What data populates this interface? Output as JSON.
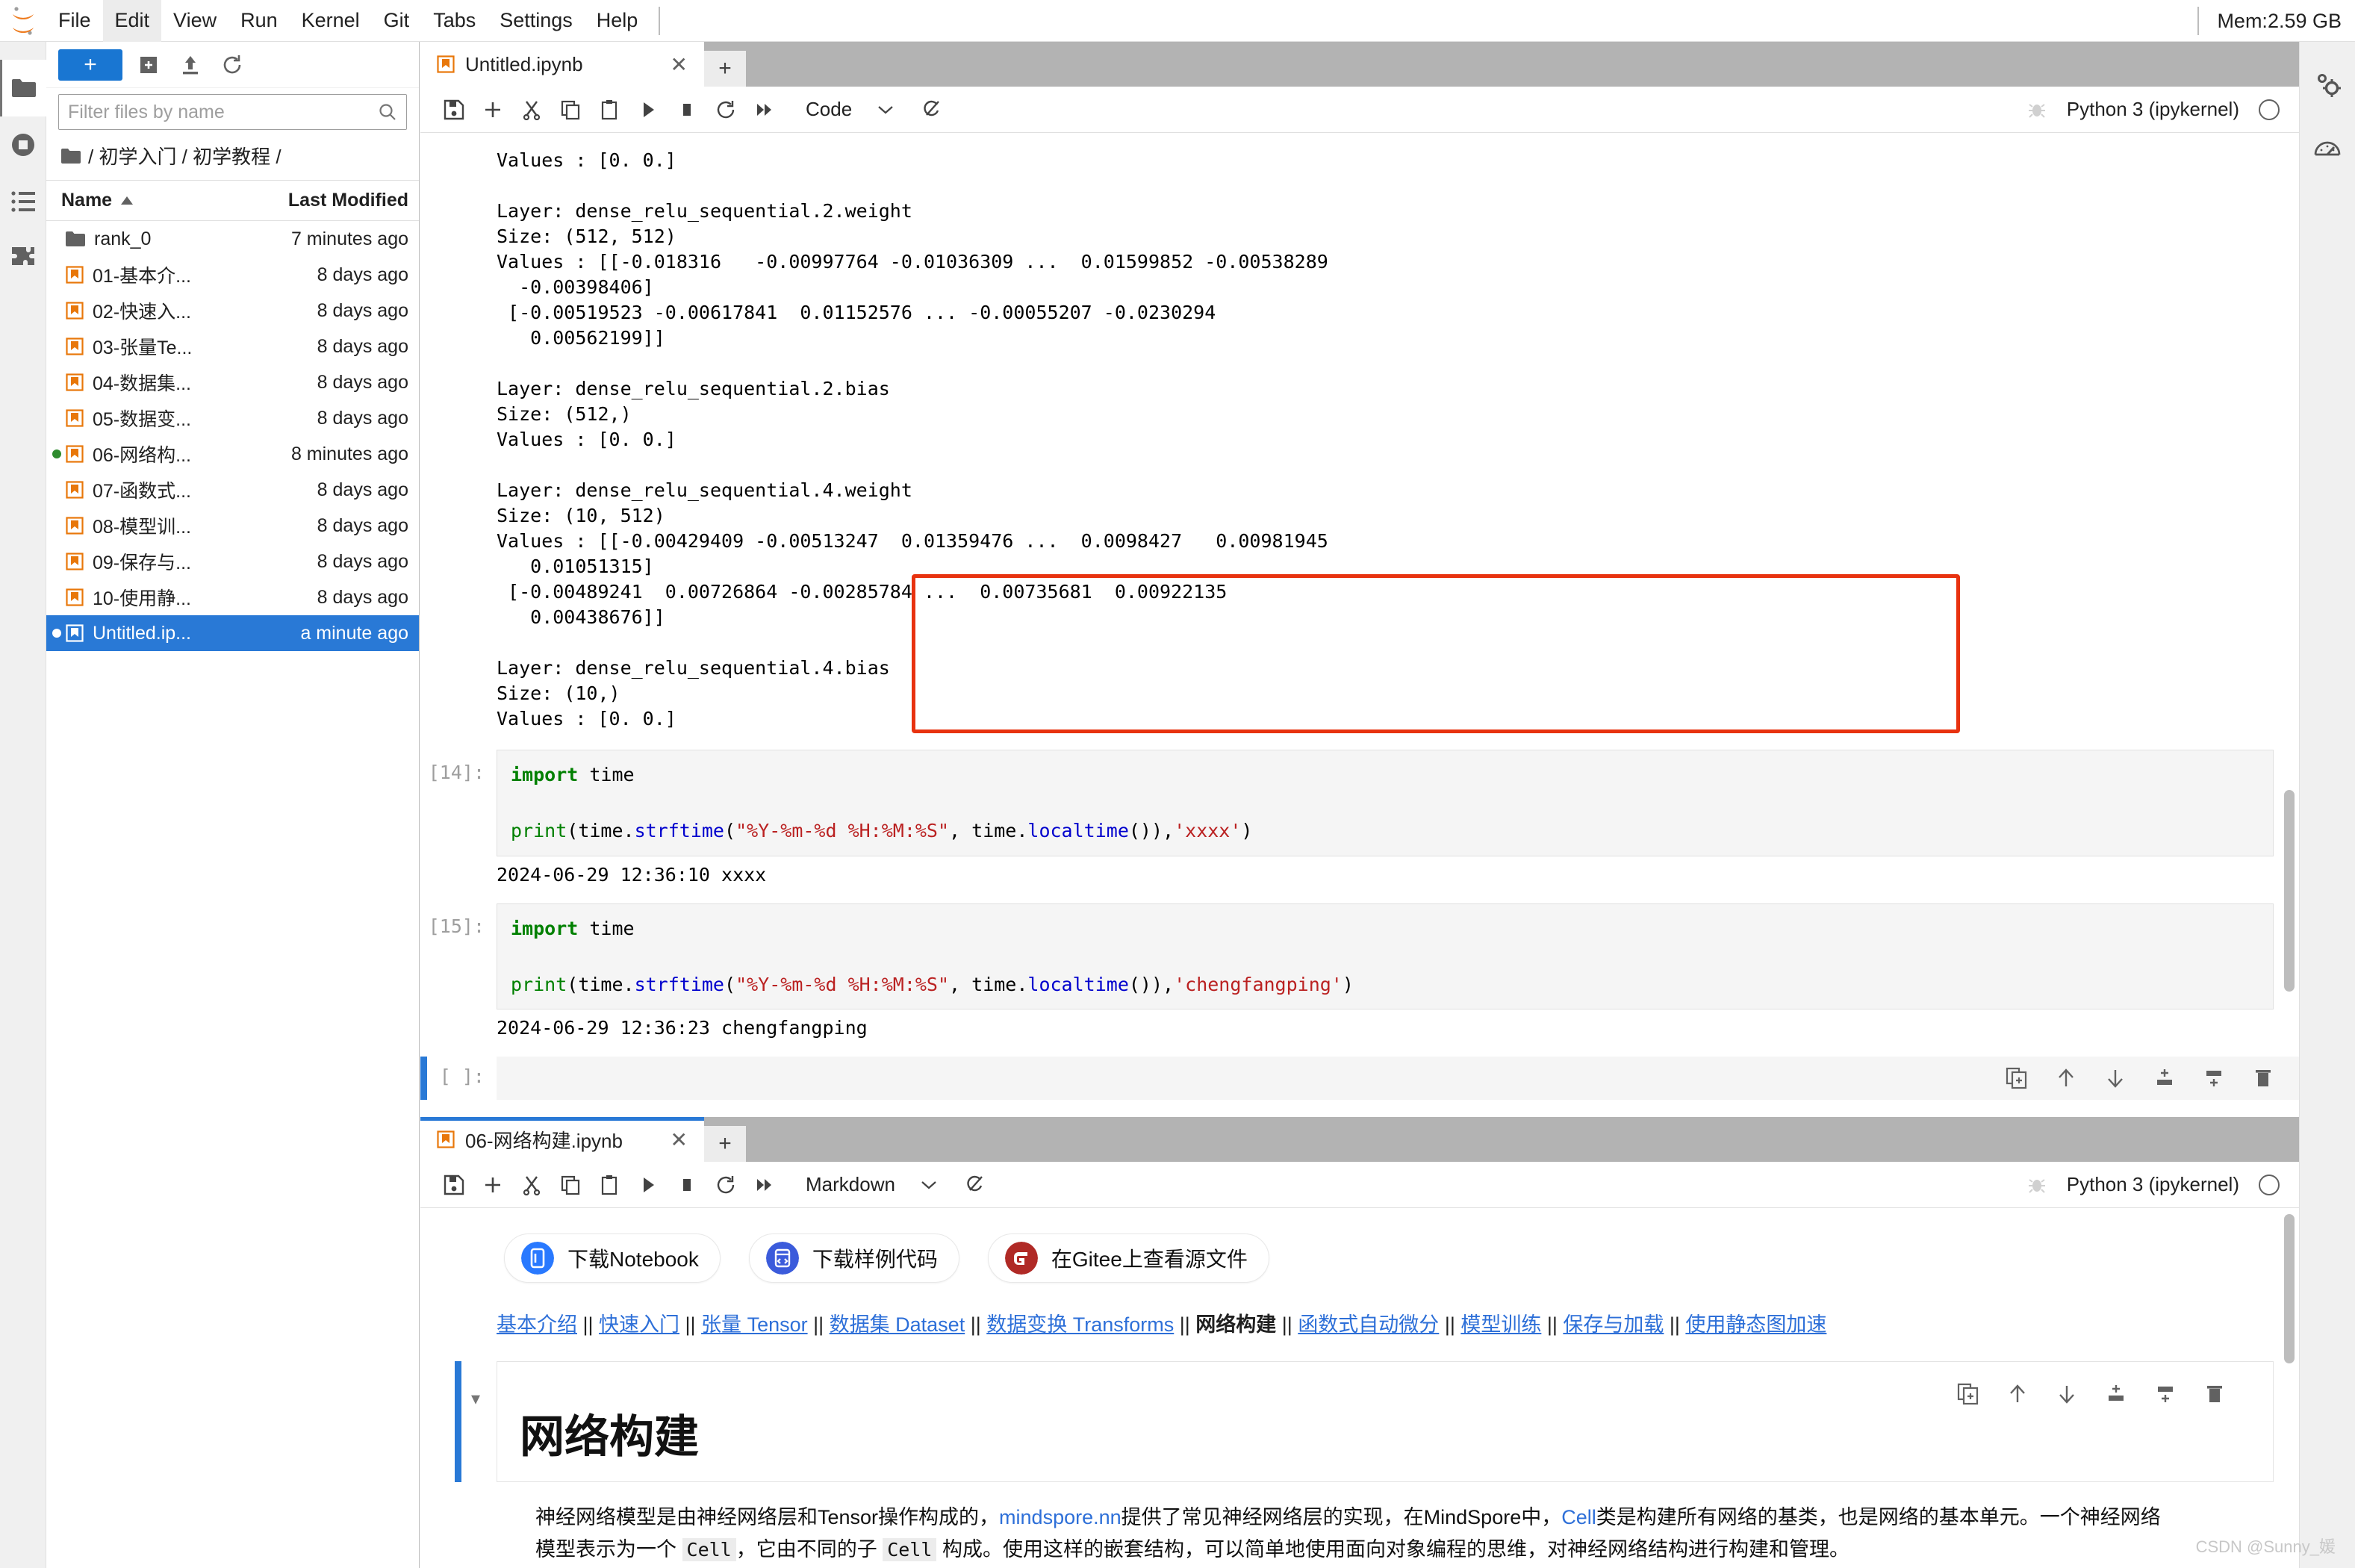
{
  "menubar": {
    "items": [
      {
        "label": "File",
        "active": false
      },
      {
        "label": "Edit",
        "active": true
      },
      {
        "label": "View",
        "active": false
      },
      {
        "label": "Run",
        "active": false
      },
      {
        "label": "Kernel",
        "active": false
      },
      {
        "label": "Git",
        "active": false
      },
      {
        "label": "Tabs",
        "active": false
      },
      {
        "label": "Settings",
        "active": false
      },
      {
        "label": "Help",
        "active": false
      }
    ],
    "memory": "Mem:2.59 GB"
  },
  "filebrowser": {
    "new_launcher_label": "+",
    "filter_placeholder": "Filter files by name",
    "filter_value": "",
    "breadcrumb": "/ 初学入门 / 初学教程 /",
    "col_name": "Name",
    "col_modified": "Last Modified",
    "rows": [
      {
        "name": "rank_0",
        "modified": "7 minutes ago",
        "type": "folder",
        "selected": false,
        "running": false
      },
      {
        "name": "01-基本介...",
        "modified": "8 days ago",
        "type": "notebook",
        "selected": false,
        "running": false
      },
      {
        "name": "02-快速入...",
        "modified": "8 days ago",
        "type": "notebook",
        "selected": false,
        "running": false
      },
      {
        "name": "03-张量Te...",
        "modified": "8 days ago",
        "type": "notebook",
        "selected": false,
        "running": false
      },
      {
        "name": "04-数据集...",
        "modified": "8 days ago",
        "type": "notebook",
        "selected": false,
        "running": false
      },
      {
        "name": "05-数据变...",
        "modified": "8 days ago",
        "type": "notebook",
        "selected": false,
        "running": false
      },
      {
        "name": "06-网络构...",
        "modified": "8 minutes ago",
        "type": "notebook",
        "selected": false,
        "running": true
      },
      {
        "name": "07-函数式...",
        "modified": "8 days ago",
        "type": "notebook",
        "selected": false,
        "running": false
      },
      {
        "name": "08-模型训...",
        "modified": "8 days ago",
        "type": "notebook",
        "selected": false,
        "running": false
      },
      {
        "name": "09-保存与...",
        "modified": "8 days ago",
        "type": "notebook",
        "selected": false,
        "running": false
      },
      {
        "name": "10-使用静...",
        "modified": "8 days ago",
        "type": "notebook",
        "selected": false,
        "running": false
      },
      {
        "name": "Untitled.ip...",
        "modified": "a minute ago",
        "type": "notebook",
        "selected": true,
        "running": true
      }
    ]
  },
  "notebook_top": {
    "tab_label": "Untitled.ipynb",
    "tab_close": "✕",
    "add_tab": "+",
    "cell_type": "Code",
    "kernel_name": "Python 3 (ipykernel)",
    "output_scrollback": "Values : [0. 0.]\n\nLayer: dense_relu_sequential.2.weight\nSize: (512, 512)\nValues : [[-0.018316   -0.00997764 -0.01036309 ...  0.01599852 -0.00538289\n  -0.00398406]\n [-0.00519523 -0.00617841  0.01152576 ... -0.00055207 -0.0230294\n   0.00562199]]\n\nLayer: dense_relu_sequential.2.bias\nSize: (512,)\nValues : [0. 0.]\n\nLayer: dense_relu_sequential.4.weight\nSize: (10, 512)\nValues : [[-0.00429409 -0.00513247  0.01359476 ...  0.0098427   0.00981945\n   0.01051315]\n [-0.00489241  0.00726864 -0.00285784 ...  0.00735681  0.00922135\n   0.00438676]]\n\nLayer: dense_relu_sequential.4.bias\nSize: (10,)\nValues : [0. 0.]",
    "cells": [
      {
        "prompt": "[14]:",
        "code_line1_kw": "import",
        "code_line1_rest": " time",
        "code_line2_parts": [
          {
            "t": "print",
            "c": "fn"
          },
          {
            "t": "(time.",
            "c": "plain"
          },
          {
            "t": "strftime",
            "c": "blue"
          },
          {
            "t": "(",
            "c": "plain"
          },
          {
            "t": "\"%Y-%m-%d %H:%M:%S\"",
            "c": "str"
          },
          {
            "t": ", time.",
            "c": "plain"
          },
          {
            "t": "localtime",
            "c": "blue"
          },
          {
            "t": "()),",
            "c": "plain"
          },
          {
            "t": "'xxxx'",
            "c": "str"
          },
          {
            "t": ")",
            "c": "plain"
          }
        ],
        "output": "2024-06-29 12:36:10 xxxx"
      },
      {
        "prompt": "[15]:",
        "code_line1_kw": "import",
        "code_line1_rest": " time",
        "code_line2_parts": [
          {
            "t": "print",
            "c": "fn"
          },
          {
            "t": "(time.",
            "c": "plain"
          },
          {
            "t": "strftime",
            "c": "blue"
          },
          {
            "t": "(",
            "c": "plain"
          },
          {
            "t": "\"%Y-%m-%d %H:%M:%S\"",
            "c": "str"
          },
          {
            "t": ", time.",
            "c": "plain"
          },
          {
            "t": "localtime",
            "c": "blue"
          },
          {
            "t": "()),",
            "c": "plain"
          },
          {
            "t": "'chengfangping'",
            "c": "str"
          },
          {
            "t": ")",
            "c": "plain"
          }
        ],
        "output": "2024-06-29 12:36:23 chengfangping"
      }
    ],
    "empty_cell_prompt": "[ ]:",
    "cell_actions": [
      "duplicate-icon",
      "move-up-icon",
      "move-down-icon",
      "insert-above-icon",
      "insert-below-icon",
      "delete-icon"
    ]
  },
  "notebook_bottom": {
    "tab_label": "06-网络构建.ipynb",
    "tab_close": "✕",
    "add_tab": "+",
    "cell_type": "Markdown",
    "kernel_name": "Python 3 (ipykernel)",
    "download_buttons": [
      {
        "label": "下载Notebook",
        "icon": "notebook-download-icon",
        "color": "#2979ff"
      },
      {
        "label": "下载样例代码",
        "icon": "code-download-icon",
        "color": "#3b5bdb"
      },
      {
        "label": "在Gitee上查看源文件",
        "icon": "gitee-icon",
        "color": "#b02a26"
      }
    ],
    "nav_links": [
      {
        "label": "基本介绍",
        "current": false
      },
      {
        "label": "快速入门",
        "current": false
      },
      {
        "label": "张量 Tensor",
        "current": false
      },
      {
        "label": "数据集 Dataset",
        "current": false
      },
      {
        "label": "数据变换 Transforms",
        "current": false
      },
      {
        "label": "网络构建",
        "current": true
      },
      {
        "label": "函数式自动微分",
        "current": false
      },
      {
        "label": "模型训练",
        "current": false
      },
      {
        "label": "保存与加载",
        "current": false
      },
      {
        "label": "使用静态图加速",
        "current": false
      }
    ],
    "nav_separator": "||",
    "heading": "网络构建",
    "collapser": "▾",
    "paragraph": [
      {
        "t": "神经网络模型是由神经网络层和Tensor操作构成的，",
        "k": "text"
      },
      {
        "t": "mindspore.nn",
        "k": "link"
      },
      {
        "t": "提供了常见神经网络层的实现，在MindSpore中，",
        "k": "text"
      },
      {
        "t": "Cell",
        "k": "link"
      },
      {
        "t": "类是构建所有网络的基类，也是网络的基本单元。一个神经网络模型表示为一个 ",
        "k": "text"
      },
      {
        "t": "Cell",
        "k": "code"
      },
      {
        "t": "，它由不同的子 ",
        "k": "text"
      },
      {
        "t": "Cell",
        "k": "code"
      },
      {
        "t": " 构成。使用这样的嵌套结构，可以简单地使用面向对象编程的思维，对神经网络结构进行构建和管理。",
        "k": "text"
      }
    ],
    "cell_actions": [
      "duplicate-icon",
      "move-up-icon",
      "move-down-icon",
      "insert-above-icon",
      "insert-below-icon",
      "delete-icon"
    ]
  },
  "watermark": "CSDN @Sunny_媛"
}
